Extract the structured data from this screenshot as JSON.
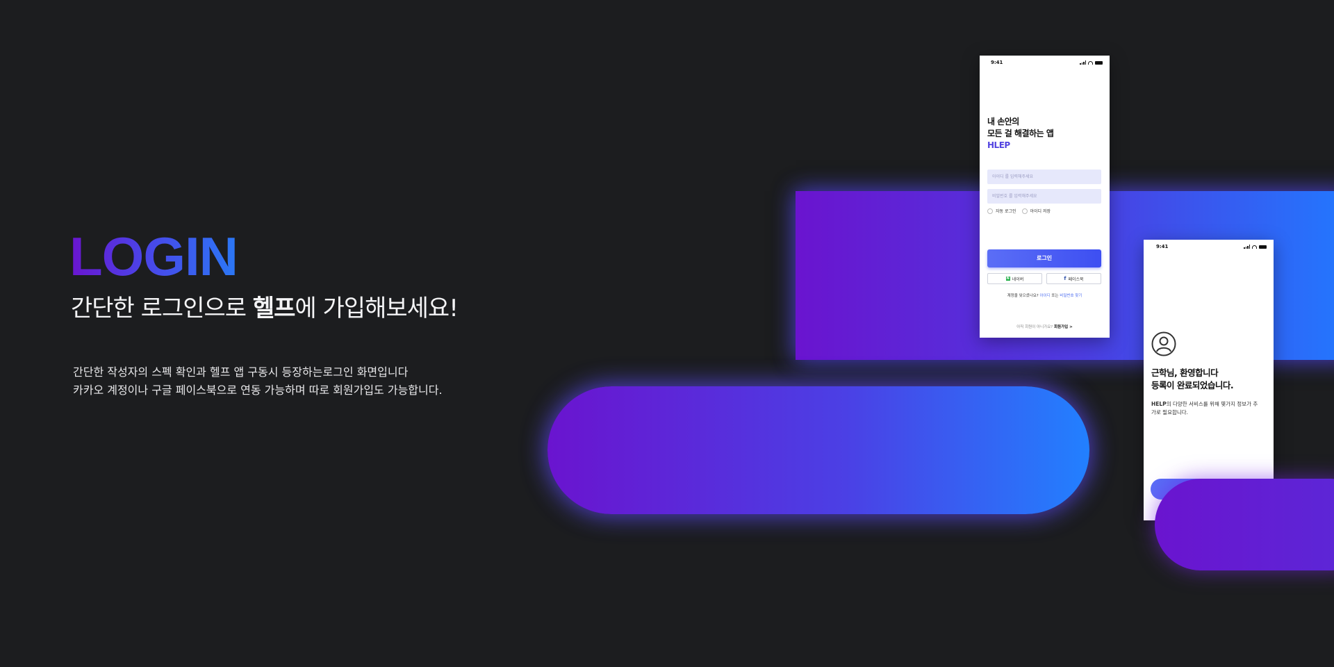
{
  "hero": {
    "title": "LOGIN",
    "subtitle_pre": "간단한 로그인으로 ",
    "subtitle_bold": "헬프",
    "subtitle_post": "에 가입해보세요!",
    "desc_line1": "간단한 작성자의 스펙 확인과 헬프 앱 구동시 등장하는로그인 화면입니다",
    "desc_line2": "카카오 계정이나 구글 페이스북으로 연동 가능하며 따로 회원가입도 가능합니다."
  },
  "login_screen": {
    "time": "9:41",
    "heading_line1": "내 손안의",
    "heading_line2": "모든 걸 해결하는 앱",
    "brand": "HLEP",
    "id_placeholder": "아이디 를 입력해주세요",
    "pw_placeholder": "비밀번호 를 입력해주세요",
    "auto_login": "자동 로그인",
    "save_id": "아이디 저장",
    "login_button": "로그인",
    "naver_button": "네이버",
    "facebook_button": "페이스북",
    "forgot_pre": "계정을 잊으셨나요?",
    "forgot_id": "아이디",
    "forgot_mid": "또는",
    "forgot_pw": "비밀번호 찾기",
    "signup_pre": "아직 회원이 아니가요?",
    "signup_link": "회원가입 >"
  },
  "welcome_screen": {
    "time": "9:41",
    "heading_line1": "근학님, 환영합니다",
    "heading_line2": "등록이 완료되었습니다.",
    "desc_bold": "HELP",
    "desc_rest": "의 다양한 서비스를 위해 몇가지 정보가 추가로 필요합니다."
  },
  "colors": {
    "background": "#1c1d1f",
    "gradient_start": "#6a14cf",
    "gradient_end": "#2278ff",
    "brand": "#5243e0"
  },
  "icons": [
    "signal-icon",
    "wifi-icon",
    "battery-icon",
    "naver-icon",
    "facebook-icon",
    "user-avatar-icon"
  ]
}
